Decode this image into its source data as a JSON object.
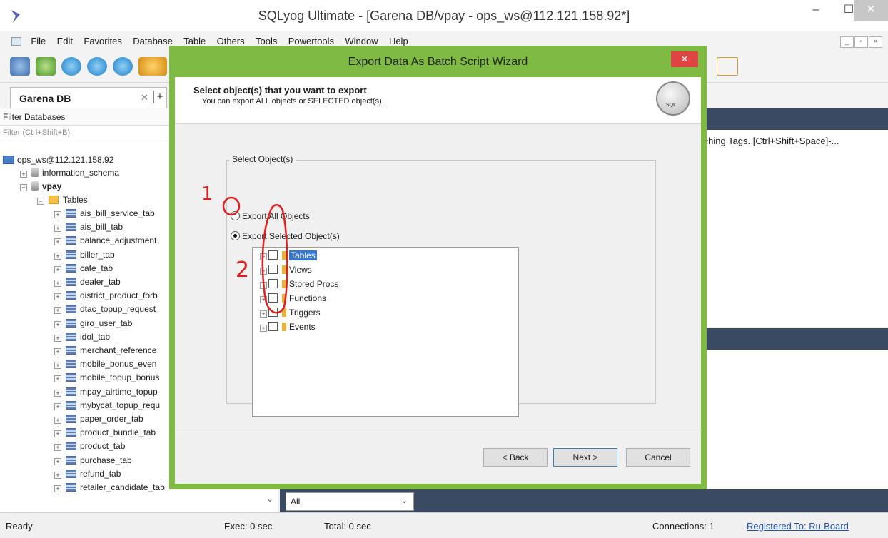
{
  "window": {
    "title": "SQLyog Ultimate - [Garena DB/vpay - ops_ws@112.121.158.92*]",
    "min": "–",
    "max": "☐",
    "close": "✕"
  },
  "menu": [
    "File",
    "Edit",
    "Favorites",
    "Database",
    "Table",
    "Others",
    "Tools",
    "Powertools",
    "Window",
    "Help"
  ],
  "connection_tab": {
    "label": "Garena DB",
    "close": "✕",
    "add": "+"
  },
  "left_panel": {
    "filter_label": "Filter Databases",
    "filter_placeholder": "Filter (Ctrl+Shift+B)",
    "server": "ops_ws@112.121.158.92",
    "databases": [
      "information_schema",
      "vpay"
    ],
    "tables_folder": "Tables",
    "tables": [
      "ais_bill_service_tab",
      "ais_bill_tab",
      "balance_adjustment",
      "biller_tab",
      "cafe_tab",
      "dealer_tab",
      "district_product_forb",
      "dtac_topup_request",
      "giro_user_tab",
      "idol_tab",
      "merchant_reference",
      "mobile_bonus_even",
      "mobile_topup_bonus",
      "mpay_airtime_topup",
      "mybycat_topup_requ",
      "paper_order_tab",
      "product_bundle_tab",
      "product_tab",
      "purchase_tab",
      "refund_tab",
      "retailer_candidate_tab"
    ]
  },
  "editor": {
    "hint": "tching Tags. [Ctrl+Shift+Space]-...",
    "result_select": "All"
  },
  "status": {
    "ready": "Ready",
    "exec": "Exec: 0 sec",
    "total": "Total: 0 sec",
    "connections": "Connections: 1",
    "registered": "Registered To: Ru-Board"
  },
  "dialog": {
    "title": "Export Data As Batch Script Wizard",
    "close": "✕",
    "header_title": "Select object(s)  that you want to export",
    "header_sub": "You can export ALL objects or SELECTED object(s).",
    "logo_text": "SQL",
    "group_label": "Select Object(s)",
    "radio_all": "Export All Objects",
    "radio_selected": "Export Selected Object(s)",
    "objects": [
      "Tables",
      "Views",
      "Stored Procs",
      "Functions",
      "Triggers",
      "Events"
    ],
    "btn_back": "< Back",
    "btn_next": "Next >",
    "btn_cancel": "Cancel"
  },
  "annotations": {
    "mark1": "1",
    "mark2": "2",
    "color": "#e02020"
  }
}
